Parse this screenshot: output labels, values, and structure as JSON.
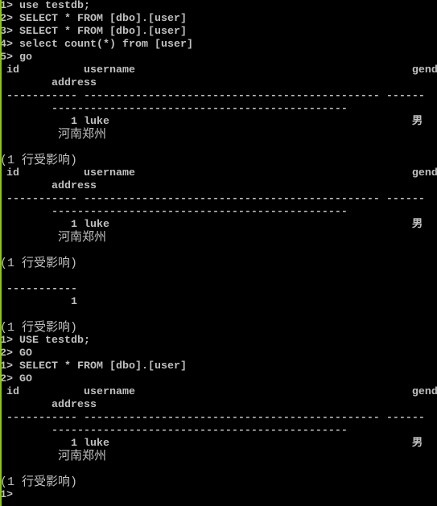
{
  "colors": {
    "background": "#000000",
    "text": "#c0c0c0",
    "window_border": "#8ec21f"
  },
  "console": {
    "lines": [
      "1> use testdb;",
      "2> SELECT * FROM [dbo].[user]",
      "3> SELECT * FROM [dbo].[user]",
      "4> select count(*) from [user]",
      "5> go",
      " id          username                                           gender",
      "        address",
      " ----------- ---------------------------------------------- ------",
      "        ----------------------------------------------",
      "           1 luke                                               男",
      "        河南郑州",
      "",
      "(1 行受影响)",
      " id          username                                           gender",
      "        address",
      " ----------- ---------------------------------------------- ------",
      "        ----------------------------------------------",
      "           1 luke                                               男",
      "        河南郑州",
      "",
      "(1 行受影响)",
      "",
      " -----------",
      "           1",
      "",
      "(1 行受影响)",
      "1> USE testdb;",
      "2> GO",
      "1> SELECT * FROM [dbo].[user]",
      "2> GO",
      " id          username                                           gender",
      "        address",
      " ----------- ---------------------------------------------- ------",
      "        ----------------------------------------------",
      "           1 luke                                               男",
      "        河南郑州",
      "",
      "(1 行受影响)",
      "1>"
    ]
  }
}
